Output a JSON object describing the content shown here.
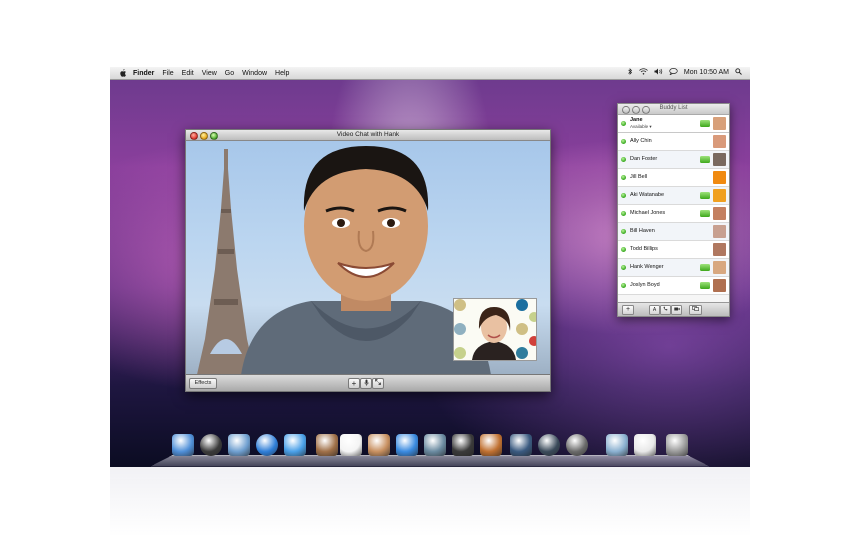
{
  "menubar": {
    "app": "Finder",
    "items": [
      "File",
      "Edit",
      "View",
      "Go",
      "Window",
      "Help"
    ],
    "clock": "Mon 10:50 AM",
    "icons": [
      "bluetooth-icon",
      "wifi-icon",
      "volume-icon",
      "ichat-status-icon",
      "spotlight-icon"
    ]
  },
  "video_chat": {
    "title": "Video Chat with Hank",
    "effects_label": "Effects",
    "controls": [
      "add-participant",
      "mute",
      "fullscreen"
    ]
  },
  "buddy_list": {
    "title": "Buddy List",
    "me": {
      "name": "Jane",
      "status": "Available ▾"
    },
    "buddies": [
      {
        "name": "Ally Chin",
        "video": false,
        "phone": false,
        "avatar": "#d99a7a"
      },
      {
        "name": "Dan Foster",
        "video": true,
        "phone": false,
        "avatar": "#7a6a60"
      },
      {
        "name": "Jill Bell",
        "video": false,
        "phone": false,
        "avatar": "#f08a10"
      },
      {
        "name": "Aki Watanabe",
        "video": true,
        "phone": false,
        "avatar": "#f0a020"
      },
      {
        "name": "Michael Jones",
        "video": false,
        "phone": true,
        "avatar": "#c48060"
      },
      {
        "name": "Bill Haven",
        "video": false,
        "phone": false,
        "avatar": "#c8a090"
      },
      {
        "name": "Todd Billips",
        "video": false,
        "phone": false,
        "avatar": "#b07860"
      },
      {
        "name": "Hank Wenger",
        "video": true,
        "phone": false,
        "avatar": "#d8a880"
      },
      {
        "name": "Joslyn Boyd",
        "video": true,
        "phone": false,
        "avatar": "#b07050"
      }
    ],
    "footer_buttons": [
      "+",
      "A",
      "phone",
      "video",
      "screen-share"
    ]
  },
  "dock": {
    "items": [
      "Finder",
      "Dashboard",
      "Mail",
      "Safari",
      "iChat",
      "Address Book",
      "iCal",
      "Preview",
      "iTunes",
      "iPhoto",
      "iMovie",
      "GarageBand",
      "Spaces",
      "Time Machine",
      "System Preferences",
      "Downloads",
      "Documents",
      "Trash"
    ]
  },
  "icons": {
    "apple": "",
    "plus": "+",
    "mic": "🎤",
    "expand": "⤢",
    "camera": "■"
  }
}
